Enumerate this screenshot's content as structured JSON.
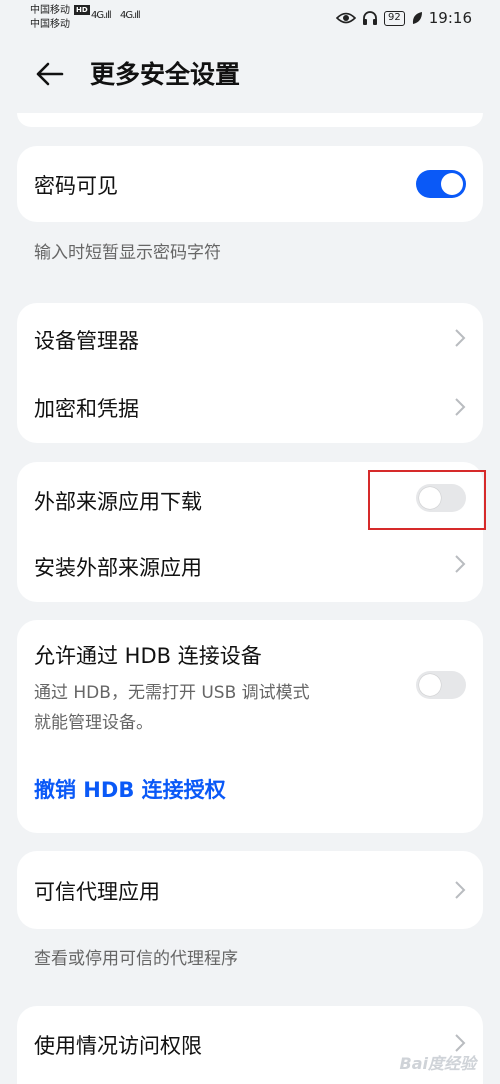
{
  "status_bar": {
    "carrier1": "中国移动",
    "carrier2": "中国移动",
    "hd": "HD",
    "signal1": "4G.ıll",
    "signal2": "4G.ıll",
    "battery": "92",
    "time": "19:16"
  },
  "header": {
    "title": "更多安全设置"
  },
  "password_visible": {
    "label": "密码可见",
    "toggle_on": true,
    "note": "输入时短暂显示密码字符"
  },
  "device_group": {
    "device_manager": "设备管理器",
    "encryption": "加密和凭据"
  },
  "external_group": {
    "external_download": "外部来源应用下载",
    "external_download_on": false,
    "install_external": "安装外部来源应用"
  },
  "hdb_group": {
    "title": "允许通过 HDB 连接设备",
    "subtitle1": "通过 HDB，无需打开 USB 调试模式",
    "subtitle2": "就能管理设备。",
    "toggle_on": false,
    "revoke": "撤销 HDB 连接授权"
  },
  "trust_agent": {
    "label": "可信代理应用",
    "note": "查看或停用可信的代理程序"
  },
  "usage_access": {
    "label": "使用情况访问权限"
  },
  "watermark": "Bai度经验",
  "colors": {
    "accent": "#0a59f7",
    "highlight": "#d62a2a",
    "background": "#f1f3f5"
  }
}
